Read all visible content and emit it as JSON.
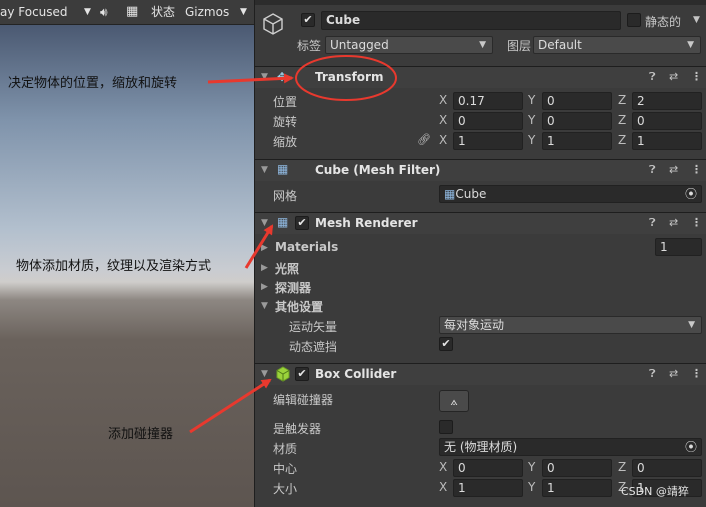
{
  "scene": {
    "toolbar": {
      "focus_mode": "ay Focused",
      "state_label": "状态",
      "gizmos_label": "Gizmos"
    },
    "annotations": {
      "transform_note": "决定物体的位置，缩放和旋转",
      "renderer_note": "物体添加材质，纹理以及渲染方式",
      "collider_note": "添加碰撞器"
    }
  },
  "inspector": {
    "object_name": "Cube",
    "static_label": "静态的",
    "tag_label": "标签",
    "tag_value": "Untagged",
    "layer_label": "图层",
    "layer_value": "Default",
    "transform": {
      "title": "Transform",
      "position_label": "位置",
      "rotation_label": "旋转",
      "scale_label": "缩放",
      "axis_x": "X",
      "axis_y": "Y",
      "axis_z": "Z",
      "position": {
        "x": "0.17",
        "y": "0",
        "z": "2"
      },
      "rotation": {
        "x": "0",
        "y": "0",
        "z": "0"
      },
      "scale": {
        "x": "1",
        "y": "1",
        "z": "1"
      }
    },
    "mesh_filter": {
      "title": "Cube (Mesh Filter)",
      "mesh_label": "网格",
      "mesh_value": "Cube"
    },
    "mesh_renderer": {
      "title": "Mesh Renderer",
      "materials_label": "Materials",
      "materials_count": "1",
      "lighting_label": "光照",
      "probes_label": "探测器",
      "additional_label": "其他设置",
      "motion_vectors_label": "运动矢量",
      "motion_vectors_value": "每对象运动",
      "dynamic_occlusion_label": "动态遮挡"
    },
    "box_collider": {
      "title": "Box Collider",
      "edit_label": "编辑碰撞器",
      "trigger_label": "是触发器",
      "material_label": "材质",
      "material_value": "无 (物理材质)",
      "center_label": "中心",
      "size_label": "大小",
      "center": {
        "x": "0",
        "y": "0",
        "z": "0"
      },
      "size": {
        "x": "1",
        "y": "1",
        "z": "1"
      }
    },
    "watermark": "CSDN @靖猝"
  },
  "colors": {
    "annotation_arrow": "#e8392e",
    "scene_toolbar": "#3c3c3c",
    "inspector_bg": "#3b3b3b",
    "collider_icon": "#9bd33b"
  }
}
